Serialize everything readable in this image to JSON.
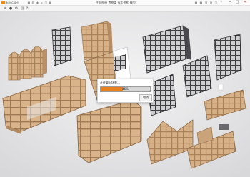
{
  "titlebar": {
    "app_name": "Enscape",
    "document_title": "主机图册 置物架 衣柜书柜 模型",
    "minimize": "–",
    "maximize": "□",
    "close": "✕"
  },
  "toolbar_icons": [
    "▣",
    "▨",
    "◈",
    "⌂",
    "▢",
    "▦",
    "☀",
    "●",
    "⚙",
    "▤",
    "↻"
  ],
  "right_icons": [
    "▦",
    "▣",
    "☰",
    "⚙",
    "▢",
    "?"
  ],
  "dialog": {
    "title": "正在载入场景…",
    "progress_fraction": 0.45,
    "progress_text": "46%",
    "cancel_label": "取消"
  },
  "colors": {
    "accent": "#e8801e",
    "wood_light": "#d9b48a",
    "wood_dark": "#a9825a",
    "metal_dark": "#3f3f42",
    "background": "#e9e9ea"
  }
}
